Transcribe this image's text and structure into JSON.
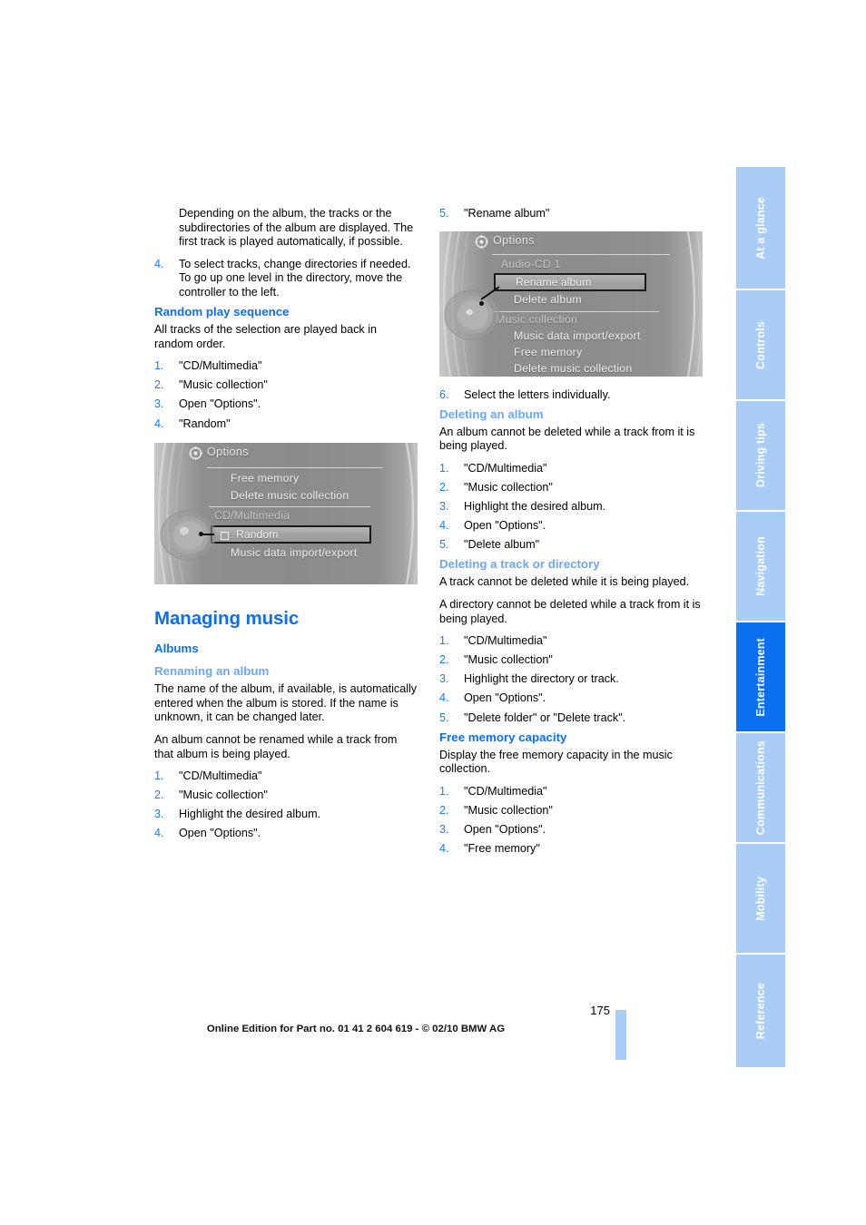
{
  "sidebar": {
    "tabs": [
      {
        "label": "At a glance",
        "active": false
      },
      {
        "label": "Controls",
        "active": false
      },
      {
        "label": "Driving tips",
        "active": false
      },
      {
        "label": "Navigation",
        "active": false
      },
      {
        "label": "Entertainment",
        "active": true
      },
      {
        "label": "Communications",
        "active": false
      },
      {
        "label": "Mobility",
        "active": false
      },
      {
        "label": "Reference",
        "active": false
      }
    ],
    "active_color": "#0b6ff0",
    "inactive_color": "#a9cdf5"
  },
  "left_column": {
    "intro_paragraph": "Depending on the album, the tracks or the subdirectories of the album are displayed. The first track is played automatically, if possible.",
    "intro_step": {
      "num": "4.",
      "text": "To select tracks, change directories if needed. To go up one level in the directory, move the controller to the left."
    },
    "random_heading": "Random play sequence",
    "random_intro": "All tracks of the selection are played back in random order.",
    "random_steps": [
      {
        "num": "1.",
        "text": "\"CD/Multimedia\""
      },
      {
        "num": "2.",
        "text": "\"Music collection\""
      },
      {
        "num": "3.",
        "text": "Open \"Options\"."
      },
      {
        "num": "4.",
        "text": "\"Random\""
      }
    ],
    "chapter_heading": "Managing music",
    "albums_heading": "Albums",
    "rename_heading": "Renaming an album",
    "rename_para_1": "The name of the album, if available, is automatically entered when the album is stored. If the name is unknown, it can be changed later.",
    "rename_para_2": "An album cannot be renamed while a track from that album is being played.",
    "rename_steps": [
      {
        "num": "1.",
        "text": "\"CD/Multimedia\""
      },
      {
        "num": "2.",
        "text": "\"Music collection\""
      },
      {
        "num": "3.",
        "text": "Highlight the desired album."
      },
      {
        "num": "4.",
        "text": "Open \"Options\"."
      }
    ]
  },
  "right_column": {
    "rename_step_5": {
      "num": "5.",
      "text": "\"Rename album\""
    },
    "rename_step_6": {
      "num": "6.",
      "text": "Select the letters individually."
    },
    "delete_album_heading": "Deleting an album",
    "delete_album_intro": "An album cannot be deleted while a track from it is being played.",
    "delete_album_steps": [
      {
        "num": "1.",
        "text": "\"CD/Multimedia\""
      },
      {
        "num": "2.",
        "text": "\"Music collection\""
      },
      {
        "num": "3.",
        "text": "Highlight the desired album."
      },
      {
        "num": "4.",
        "text": "Open \"Options\"."
      },
      {
        "num": "5.",
        "text": "\"Delete album\""
      }
    ],
    "delete_track_heading": "Deleting a track or directory",
    "delete_track_para_1": "A track cannot be deleted while it is being played.",
    "delete_track_para_2": "A directory cannot be deleted while a track from it is being played.",
    "delete_track_steps": [
      {
        "num": "1.",
        "text": "\"CD/Multimedia\""
      },
      {
        "num": "2.",
        "text": "\"Music collection\""
      },
      {
        "num": "3.",
        "text": "Highlight the directory or track."
      },
      {
        "num": "4.",
        "text": "Open \"Options\"."
      },
      {
        "num": "5.",
        "text": "\"Delete folder\" or \"Delete track\"."
      }
    ],
    "free_memory_heading": "Free memory capacity",
    "free_memory_intro": "Display the free memory capacity in the music collection.",
    "free_memory_steps": [
      {
        "num": "1.",
        "text": "\"CD/Multimedia\""
      },
      {
        "num": "2.",
        "text": "\"Music collection\""
      },
      {
        "num": "3.",
        "text": "Open \"Options\"."
      },
      {
        "num": "4.",
        "text": "\"Free memory\""
      }
    ]
  },
  "screenshot_random": {
    "title": "Options",
    "icon": "gear-icon",
    "items": [
      "Free memory",
      "Delete music collection",
      "CD/Multimedia",
      "Music data import/export"
    ],
    "group_label": "CD/Multimedia",
    "selected_item": "Random",
    "selected_has_checkbox": true
  },
  "screenshot_rename": {
    "title": "Options",
    "icon": "gear-icon",
    "group_label_top": "Audio-CD 1",
    "group_label_mid": "Music collection",
    "selected_item": "Rename album",
    "items_upper": [
      "Delete album"
    ],
    "items_lower": [
      "Music data import/export",
      "Free memory",
      "Delete music collection"
    ]
  },
  "footer": {
    "page_number": "175",
    "edition_note": "Online Edition for Part no. 01 41 2 604 619 - © 02/10 BMW AG"
  }
}
